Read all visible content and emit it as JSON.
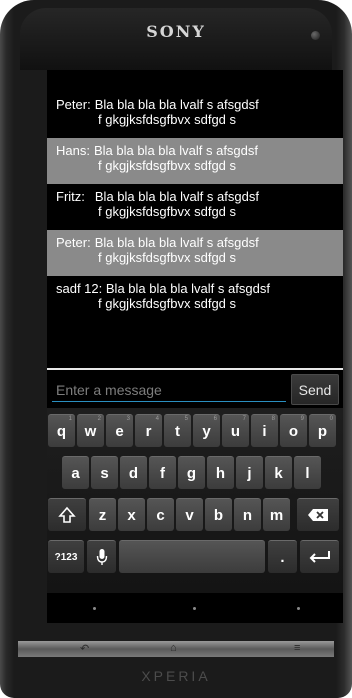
{
  "device": {
    "brand": "SONY",
    "model": "XPERIA"
  },
  "messages": [
    {
      "sender": "Peter:",
      "line1": "Bla bla bla bla lvalf s afsgdsf",
      "line2": "f gkgjksfdsgfbvx sdfgd s",
      "highlight": false
    },
    {
      "sender": "Hans:",
      "line1": "Bla bla bla bla lvalf s afsgdsf",
      "line2": "f gkgjksfdsgfbvx sdfgd s",
      "highlight": true
    },
    {
      "sender": "Fritz:",
      "line1": "Bla bla bla bla lvalf s afsgdsf",
      "line2": "f gkgjksfdsgfbvx sdfgd s",
      "highlight": false
    },
    {
      "sender": "Peter:",
      "line1": "Bla bla bla bla lvalf s afsgdsf",
      "line2": "f gkgjksfdsgfbvx sdfgd s",
      "highlight": true
    },
    {
      "sender": "sadf 12:",
      "line1": "Bla bla bla bla lvalf s afsgdsf",
      "line2": "f gkgjksfdsgfbvx sdfgd s",
      "highlight": false
    }
  ],
  "composer": {
    "placeholder": "Enter a message",
    "value": "",
    "send_label": "Send"
  },
  "keyboard": {
    "row1": [
      {
        "label": "q",
        "hint": "1"
      },
      {
        "label": "w",
        "hint": "2"
      },
      {
        "label": "e",
        "hint": "3"
      },
      {
        "label": "r",
        "hint": "4"
      },
      {
        "label": "t",
        "hint": "5"
      },
      {
        "label": "y",
        "hint": "6"
      },
      {
        "label": "u",
        "hint": "7"
      },
      {
        "label": "i",
        "hint": "8"
      },
      {
        "label": "o",
        "hint": "9"
      },
      {
        "label": "p",
        "hint": "0"
      }
    ],
    "row2": [
      "a",
      "s",
      "d",
      "f",
      "g",
      "h",
      "j",
      "k",
      "l"
    ],
    "row3": [
      "z",
      "x",
      "c",
      "v",
      "b",
      "n",
      "m"
    ],
    "shift_icon": "shift-arrow-icon",
    "delete_icon": "backspace-icon",
    "symbols_label": "?123",
    "mic_icon": "microphone-icon",
    "period_label": ".",
    "enter_icon": "enter-icon"
  },
  "hardware_buttons": {
    "back_icon": "back-icon",
    "home_icon": "home-icon",
    "menu_icon": "menu-icon"
  },
  "colors": {
    "accent": "#2a8fc0",
    "highlight_row": "#8a8a8a"
  }
}
